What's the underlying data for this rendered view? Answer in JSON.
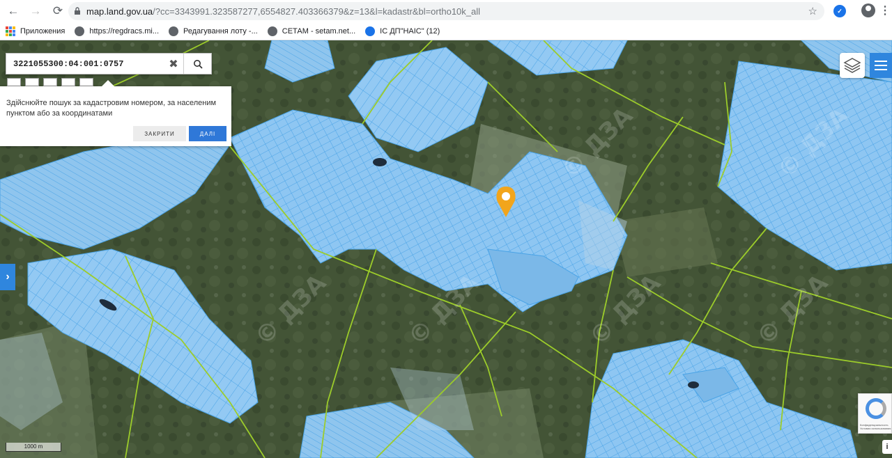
{
  "browser": {
    "url_host": "map.land.gov.ua",
    "url_rest": "/?cc=3343991.323587277,6554827.403366379&z=13&l=kadastr&bl=ortho10k_all",
    "bookmarks": [
      {
        "label": "Приложения",
        "icon": "apps-icon"
      },
      {
        "label": "https://regdracs.mi...",
        "icon": "globe-icon"
      },
      {
        "label": "Редагування лоту -...",
        "icon": "globe-icon"
      },
      {
        "label": "СЕТАМ - setam.net...",
        "icon": "globe-icon"
      },
      {
        "label": "ІС ДП\"НАІС\" (12)",
        "icon": "nais-icon"
      }
    ]
  },
  "search": {
    "value": "3221055300:04:001:0757"
  },
  "hint": {
    "text": "Здійснюйте пошук за кадастровим номером, за населеним пунктом або за координатами",
    "close_label": "ЗАКРИТИ",
    "next_label": "ДАЛІ"
  },
  "map": {
    "scale_label": "1000 m",
    "watermark": "© ДЗА",
    "marker_color": "#f2a51c",
    "parcel_fill": "#8ec6f2",
    "parcel_stroke": "#4aa3e6",
    "boundary_color": "#9ccc2a"
  },
  "recaptcha": {
    "line1": "Конфиденциальность",
    "line2": "Условия использования"
  },
  "info_label": "i"
}
